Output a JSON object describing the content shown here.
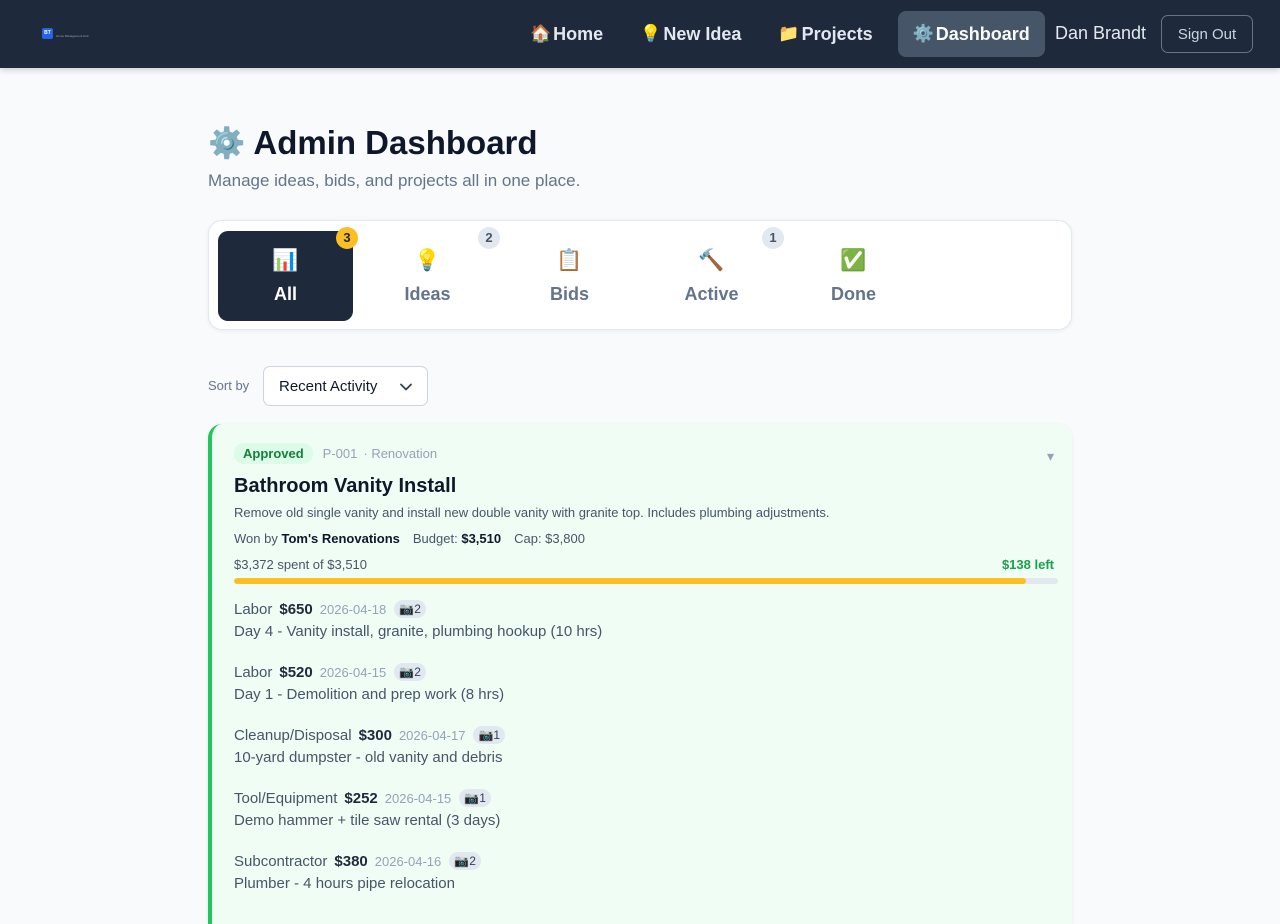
{
  "nav": {
    "logo_mark": "BT",
    "logo_text": "Home Management Hub",
    "links": [
      {
        "icon": "🏠",
        "label": "Home"
      },
      {
        "icon": "💡",
        "label": "New Idea"
      },
      {
        "icon": "📁",
        "label": "Projects"
      },
      {
        "icon": "⚙️",
        "label": "Dashboard"
      }
    ],
    "user_name": "Dan Brandt",
    "sign_out": "Sign Out"
  },
  "header": {
    "icon": "⚙️",
    "title": "Admin Dashboard",
    "subtitle": "Manage ideas, bids, and projects all in one place."
  },
  "tabs": [
    {
      "icon": "📊",
      "label": "All",
      "badge": "3"
    },
    {
      "icon": "💡",
      "label": "Ideas",
      "badge": "2"
    },
    {
      "icon": "📋",
      "label": "Bids",
      "badge": ""
    },
    {
      "icon": "🔨",
      "label": "Active",
      "badge": "1"
    },
    {
      "icon": "✅",
      "label": "Done",
      "badge": ""
    }
  ],
  "sort": {
    "label": "Sort by",
    "selected": "Recent Activity"
  },
  "project": {
    "status": "Approved",
    "id": "P-001",
    "category": "· Renovation",
    "collapse_icon": "▾",
    "title": "Bathroom Vanity Install",
    "description": "Remove old single vanity and install new double vanity with granite top. Includes plumbing adjustments.",
    "won_by_label": "Won by",
    "won_by": "Tom's Renovations",
    "budget_label": "Budget:",
    "budget": "$3,510",
    "cap_text": "Cap: $3,800",
    "spent_text": "$3,372 spent of $3,510",
    "left_text": "$138 left",
    "progress_fraction": 0.9607,
    "expenses": [
      {
        "category": "Labor",
        "amount": "$650",
        "date": "2026-04-18",
        "photos": "📷2",
        "description": "Day 4 - Vanity install, granite, plumbing hookup (10 hrs)"
      },
      {
        "category": "Labor",
        "amount": "$520",
        "date": "2026-04-15",
        "photos": "📷2",
        "description": "Day 1 - Demolition and prep work (8 hrs)"
      },
      {
        "category": "Cleanup/Disposal",
        "amount": "$300",
        "date": "2026-04-17",
        "photos": "📷1",
        "description": "10-yard dumpster - old vanity and debris"
      },
      {
        "category": "Tool/Equipment",
        "amount": "$252",
        "date": "2026-04-15",
        "photos": "📷1",
        "description": "Demo hammer + tile saw rental (3 days)"
      },
      {
        "category": "Subcontractor",
        "amount": "$380",
        "date": "2026-04-16",
        "photos": "📷2",
        "description": "Plumber - 4 hours pipe relocation"
      }
    ]
  },
  "colors": {
    "nav_bg": "#1e293b",
    "accent_green": "#22c55e",
    "progress": "#fbbf24",
    "badge_gold": "#fbbf24"
  }
}
